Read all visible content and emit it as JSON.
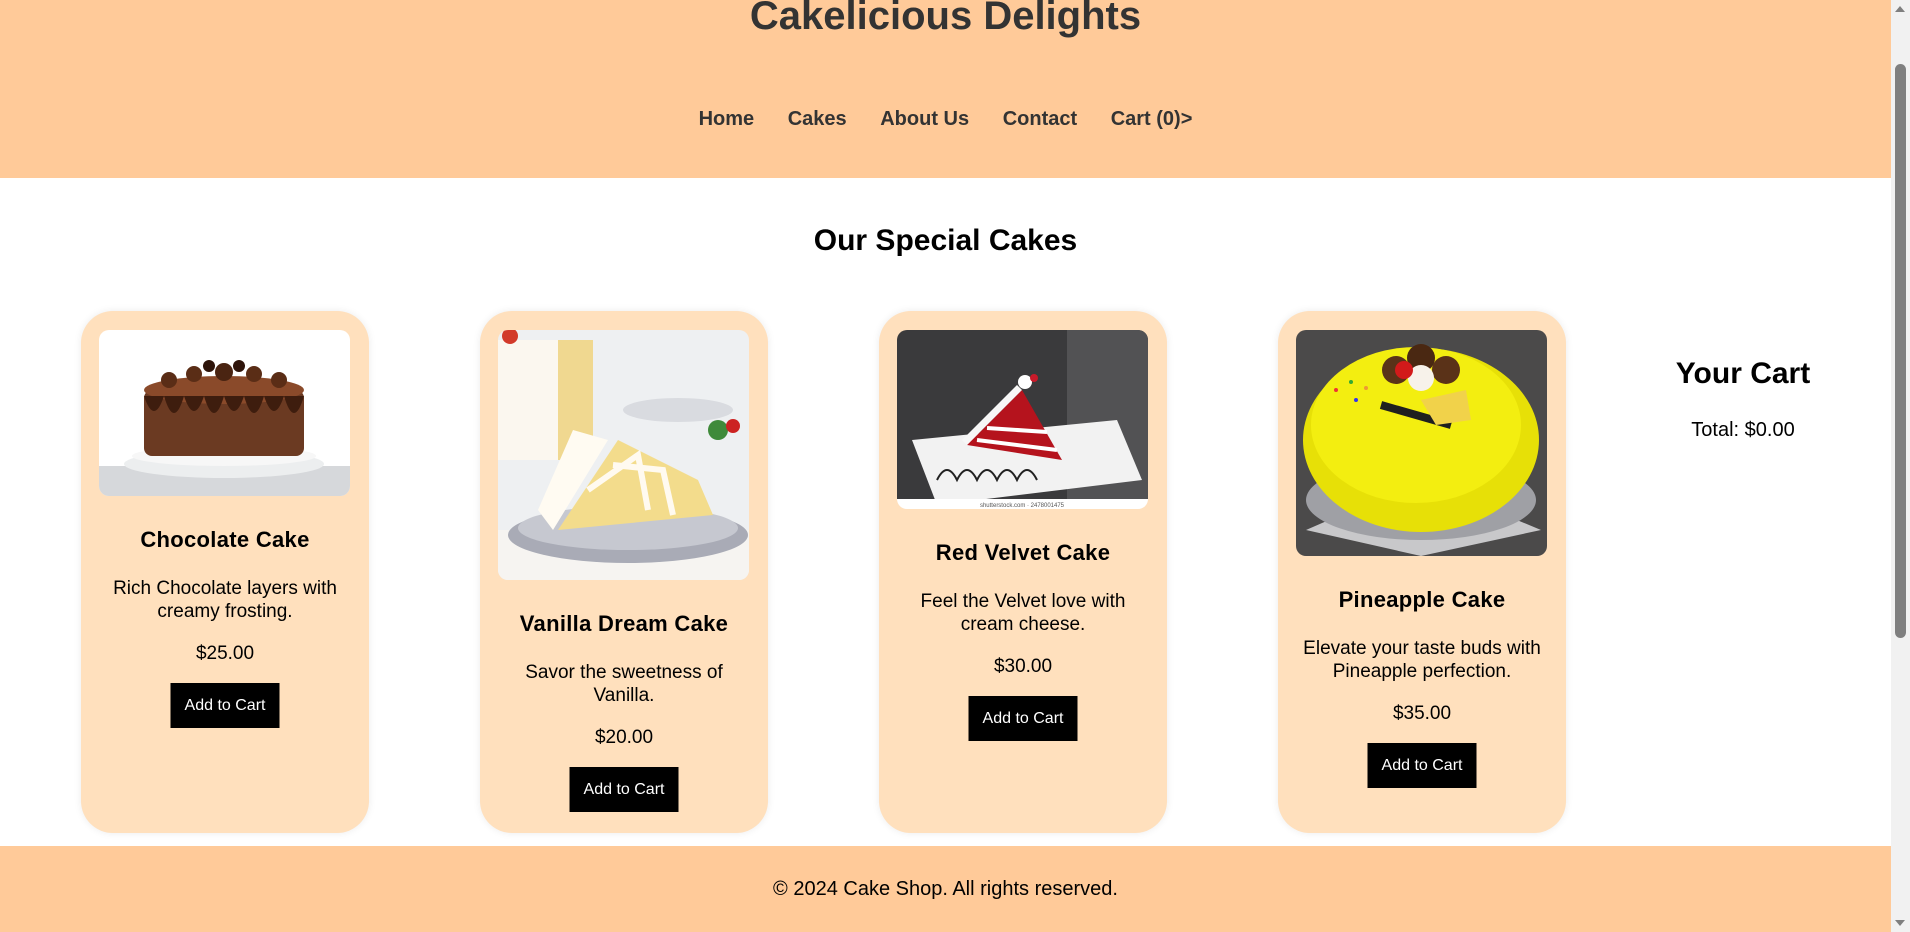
{
  "header": {
    "title": "Cakelicious Delights",
    "nav": [
      "Home",
      "Cakes",
      "About Us",
      "Contact",
      "Cart (0)>"
    ]
  },
  "main": {
    "section_title": "Our Special Cakes",
    "cakes": [
      {
        "name": "Chocolate Cake",
        "description": "Rich Chocolate layers with creamy frosting.",
        "price": "$25.00",
        "button": "Add to Cart"
      },
      {
        "name": "Vanilla Dream Cake",
        "description": "Savor the sweetness of Vanilla.",
        "price": "$20.00",
        "button": "Add to Cart"
      },
      {
        "name": "Red Velvet Cake",
        "description": "Feel the Velvet love with cream cheese.",
        "price": "$30.00",
        "button": "Add to Cart",
        "image_caption": "shutterstock.com · 2478001475"
      },
      {
        "name": "Pineapple Cake",
        "description": "Elevate your taste buds with Pineapple perfection.",
        "price": "$35.00",
        "button": "Add to Cart"
      }
    ]
  },
  "cart": {
    "title": "Your Cart",
    "total": "Total: $0.00"
  },
  "footer": {
    "text": "© 2024 Cake Shop. All rights reserved."
  },
  "colors": {
    "header_bg": "#ffca99",
    "card_bg": "#ffe0bd",
    "button_bg": "#000000"
  }
}
